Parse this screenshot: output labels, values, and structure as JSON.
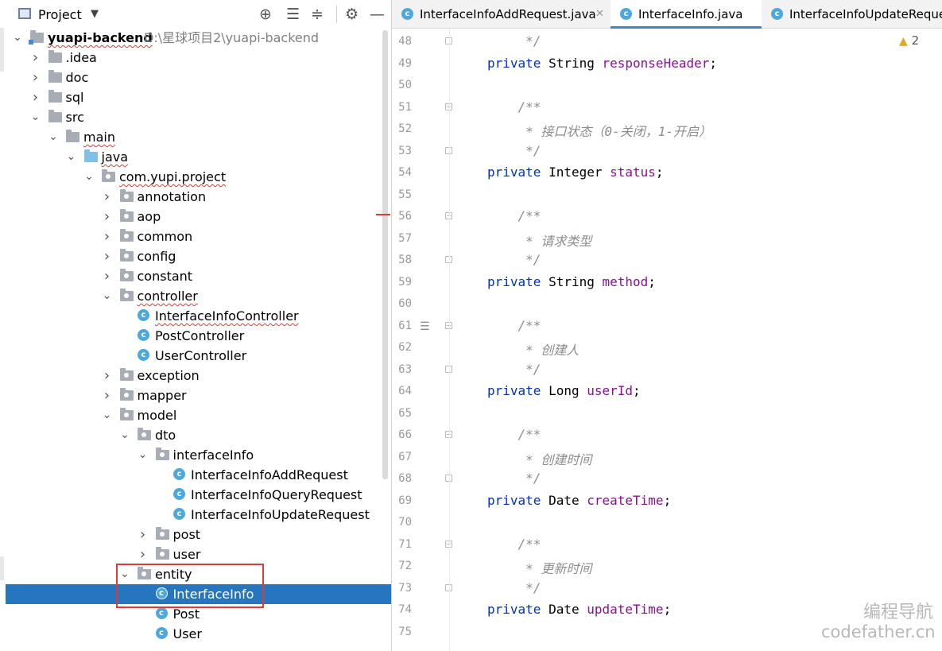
{
  "project_panel": {
    "title": "Project",
    "toolbar_icons": [
      "locate-icon",
      "expand-all-icon",
      "collapse-all-icon",
      "settings-icon",
      "hide-icon"
    ],
    "root_path": "D:\\星球项目2\\yuapi-backend",
    "tree": [
      {
        "label": "yuapi-backend",
        "depth": 0,
        "kind": "module",
        "expanded": true,
        "bold": true,
        "squiggle": true
      },
      {
        "label": ".idea",
        "depth": 1,
        "kind": "folder",
        "expanded": false
      },
      {
        "label": "doc",
        "depth": 1,
        "kind": "folder",
        "expanded": false
      },
      {
        "label": "sql",
        "depth": 1,
        "kind": "folder",
        "expanded": false
      },
      {
        "label": "src",
        "depth": 1,
        "kind": "folder",
        "expanded": true
      },
      {
        "label": "main",
        "depth": 2,
        "kind": "folder",
        "expanded": true,
        "squiggle": true
      },
      {
        "label": "java",
        "depth": 3,
        "kind": "source",
        "expanded": true,
        "squiggle": true
      },
      {
        "label": "com.yupi.project",
        "depth": 4,
        "kind": "package",
        "expanded": true,
        "squiggle": true
      },
      {
        "label": "annotation",
        "depth": 5,
        "kind": "package",
        "expanded": false
      },
      {
        "label": "aop",
        "depth": 5,
        "kind": "package",
        "expanded": false
      },
      {
        "label": "common",
        "depth": 5,
        "kind": "package",
        "expanded": false
      },
      {
        "label": "config",
        "depth": 5,
        "kind": "package",
        "expanded": false
      },
      {
        "label": "constant",
        "depth": 5,
        "kind": "package",
        "expanded": false
      },
      {
        "label": "controller",
        "depth": 5,
        "kind": "package",
        "expanded": true,
        "squiggle": true
      },
      {
        "label": "InterfaceInfoController",
        "depth": 6,
        "kind": "class",
        "squiggle": true
      },
      {
        "label": "PostController",
        "depth": 6,
        "kind": "class"
      },
      {
        "label": "UserController",
        "depth": 6,
        "kind": "class"
      },
      {
        "label": "exception",
        "depth": 5,
        "kind": "package",
        "expanded": false
      },
      {
        "label": "mapper",
        "depth": 5,
        "kind": "package",
        "expanded": false
      },
      {
        "label": "model",
        "depth": 5,
        "kind": "package",
        "expanded": true
      },
      {
        "label": "dto",
        "depth": 6,
        "kind": "package",
        "expanded": true
      },
      {
        "label": "interfaceInfo",
        "depth": 7,
        "kind": "package",
        "expanded": true
      },
      {
        "label": "InterfaceInfoAddRequest",
        "depth": 8,
        "kind": "class"
      },
      {
        "label": "InterfaceInfoQueryRequest",
        "depth": 8,
        "kind": "class"
      },
      {
        "label": "InterfaceInfoUpdateRequest",
        "depth": 8,
        "kind": "class"
      },
      {
        "label": "post",
        "depth": 7,
        "kind": "package",
        "expanded": false
      },
      {
        "label": "user",
        "depth": 7,
        "kind": "package",
        "expanded": false
      },
      {
        "label": "entity",
        "depth": 6,
        "kind": "package",
        "expanded": true
      },
      {
        "label": "InterfaceInfo",
        "depth": 7,
        "kind": "class",
        "selected": true
      },
      {
        "label": "Post",
        "depth": 7,
        "kind": "class"
      },
      {
        "label": "User",
        "depth": 7,
        "kind": "class"
      }
    ]
  },
  "editor": {
    "tabs": [
      {
        "label": "InterfaceInfoAddRequest.java",
        "active": false,
        "closable": true
      },
      {
        "label": "InterfaceInfo.java",
        "active": true,
        "closable": false
      },
      {
        "label": "InterfaceInfoUpdateReque",
        "active": false,
        "closable": false
      }
    ],
    "warning_count": "2",
    "lines": [
      {
        "n": "48",
        "parts": [
          {
            "t": "     */",
            "c": "cm"
          }
        ],
        "fold": "close"
      },
      {
        "n": "49",
        "parts": [
          {
            "t": "private ",
            "c": "kw"
          },
          {
            "t": "String ",
            "c": ""
          },
          {
            "t": "responseHeader",
            "c": "fld"
          },
          {
            "t": ";",
            "c": ""
          }
        ]
      },
      {
        "n": "50",
        "parts": []
      },
      {
        "n": "51",
        "parts": [
          {
            "t": "    /**",
            "c": "cm"
          }
        ],
        "fold": "open"
      },
      {
        "n": "52",
        "parts": [
          {
            "t": "     * 接口状态（0-关闭，1-开启）",
            "c": "cm"
          }
        ]
      },
      {
        "n": "53",
        "parts": [
          {
            "t": "     */",
            "c": "cm"
          }
        ],
        "fold": "close"
      },
      {
        "n": "54",
        "parts": [
          {
            "t": "private ",
            "c": "kw"
          },
          {
            "t": "Integer ",
            "c": ""
          },
          {
            "t": "status",
            "c": "fld"
          },
          {
            "t": ";",
            "c": ""
          }
        ]
      },
      {
        "n": "55",
        "parts": []
      },
      {
        "n": "56",
        "parts": [
          {
            "t": "    /**",
            "c": "cm"
          }
        ],
        "fold": "open"
      },
      {
        "n": "57",
        "parts": [
          {
            "t": "     * 请求类型",
            "c": "cm"
          }
        ]
      },
      {
        "n": "58",
        "parts": [
          {
            "t": "     */",
            "c": "cm"
          }
        ],
        "fold": "close"
      },
      {
        "n": "59",
        "parts": [
          {
            "t": "private ",
            "c": "kw"
          },
          {
            "t": "String ",
            "c": ""
          },
          {
            "t": "method",
            "c": "fld"
          },
          {
            "t": ";",
            "c": ""
          }
        ]
      },
      {
        "n": "60",
        "parts": []
      },
      {
        "n": "61",
        "parts": [
          {
            "t": "    /**",
            "c": "cm"
          }
        ],
        "fold": "open",
        "doc": true
      },
      {
        "n": "62",
        "parts": [
          {
            "t": "     * 创建人",
            "c": "cm"
          }
        ]
      },
      {
        "n": "63",
        "parts": [
          {
            "t": "     */",
            "c": "cm"
          }
        ],
        "fold": "close"
      },
      {
        "n": "64",
        "parts": [
          {
            "t": "private ",
            "c": "kw"
          },
          {
            "t": "Long ",
            "c": ""
          },
          {
            "t": "userId",
            "c": "fld"
          },
          {
            "t": ";",
            "c": ""
          }
        ]
      },
      {
        "n": "65",
        "parts": []
      },
      {
        "n": "66",
        "parts": [
          {
            "t": "    /**",
            "c": "cm"
          }
        ],
        "fold": "open"
      },
      {
        "n": "67",
        "parts": [
          {
            "t": "     * 创建时间",
            "c": "cm"
          }
        ]
      },
      {
        "n": "68",
        "parts": [
          {
            "t": "     */",
            "c": "cm"
          }
        ],
        "fold": "close"
      },
      {
        "n": "69",
        "parts": [
          {
            "t": "private ",
            "c": "kw"
          },
          {
            "t": "Date ",
            "c": ""
          },
          {
            "t": "createTime",
            "c": "fld"
          },
          {
            "t": ";",
            "c": ""
          }
        ]
      },
      {
        "n": "70",
        "parts": []
      },
      {
        "n": "71",
        "parts": [
          {
            "t": "    /**",
            "c": "cm"
          }
        ],
        "fold": "open"
      },
      {
        "n": "72",
        "parts": [
          {
            "t": "     * 更新时间",
            "c": "cm"
          }
        ]
      },
      {
        "n": "73",
        "parts": [
          {
            "t": "     */",
            "c": "cm"
          }
        ],
        "fold": "close"
      },
      {
        "n": "74",
        "parts": [
          {
            "t": "private ",
            "c": "kw"
          },
          {
            "t": "Date ",
            "c": ""
          },
          {
            "t": "updateTime",
            "c": "fld"
          },
          {
            "t": ";",
            "c": ""
          }
        ]
      },
      {
        "n": "75",
        "parts": []
      }
    ]
  },
  "watermark": {
    "line1": "编程导航",
    "line2": "codefather.cn"
  },
  "colors": {
    "selection": "#2675bf",
    "keyword": "#0033b3",
    "field": "#871094",
    "comment": "#8c8c8c",
    "highlight_box": "#e0393c"
  }
}
